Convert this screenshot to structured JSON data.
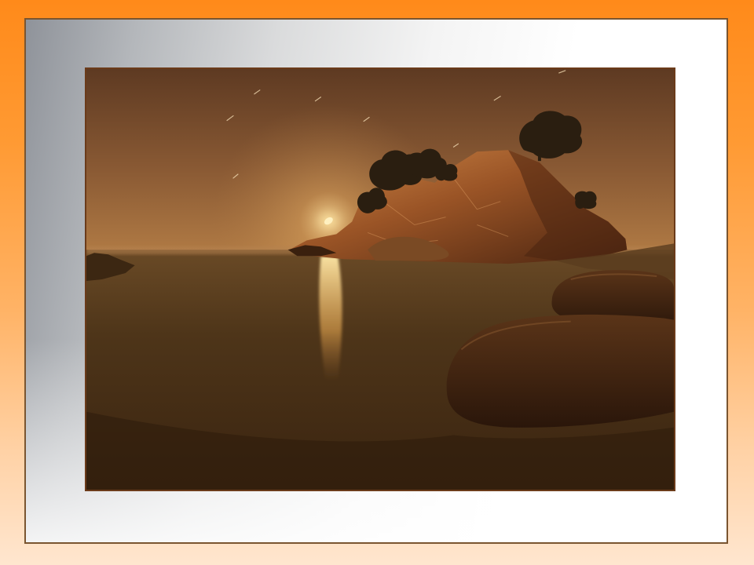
{
  "scene": {
    "subject": "",
    "colors": {
      "sky_top": "#6a4226",
      "sky_horizon": "#b07a44",
      "water": "#4a3318",
      "rock": "#8a4a22",
      "moon": "#fff4c8"
    }
  }
}
